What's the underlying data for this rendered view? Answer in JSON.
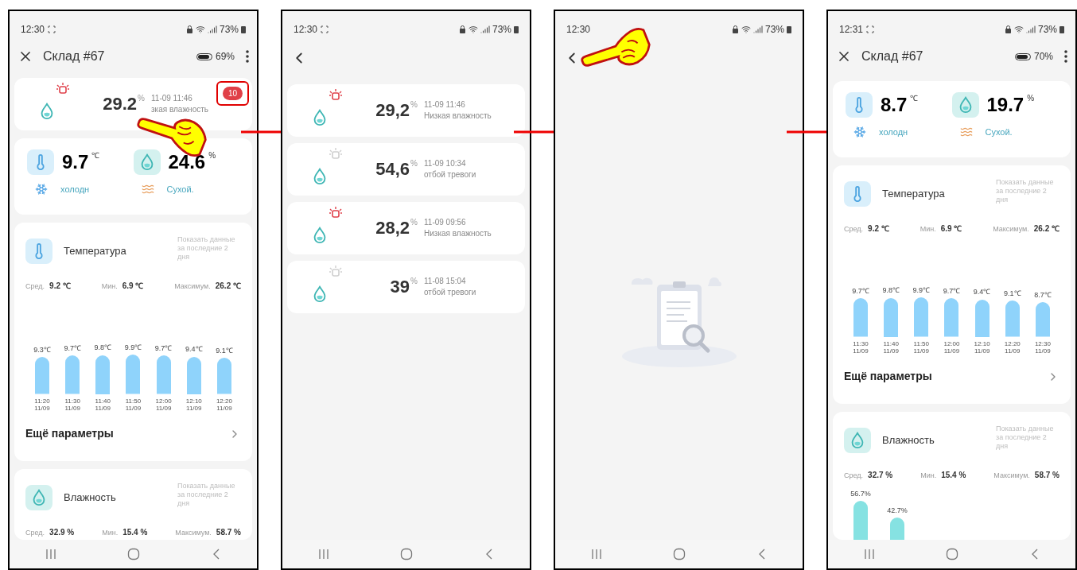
{
  "screens": [
    {
      "kind": "device",
      "pointer": true,
      "arrow_after": true,
      "status_bar": {
        "time": "12:30",
        "battery": "73%"
      },
      "header": {
        "title": "Склад #67",
        "battery": "69%"
      },
      "alert": {
        "value": "29.2",
        "unit": "%",
        "time": "11-09 11:46",
        "message": "зкая влажность",
        "alarm": true,
        "badge": "10",
        "highlighted": true
      },
      "readings": [
        {
          "kind": "temperature",
          "value": "9.7",
          "unit": "℃",
          "status": "холодн"
        },
        {
          "kind": "humidity",
          "value": "24.6",
          "unit": "%",
          "status": "Сухой."
        }
      ],
      "sections": [
        {
          "kind": "temperature",
          "title": "Температура",
          "hint": "Показать данные за последние 2 дня",
          "stats": [
            {
              "label": "Сред.",
              "value": "9.2",
              "unit": "℃"
            },
            {
              "label": "Мин.",
              "value": "6.9",
              "unit": "℃"
            },
            {
              "label": "Максимум.",
              "value": "26.2",
              "unit": "℃"
            }
          ],
          "chart_data": {
            "type": "bar",
            "categories": [
              "11:20 11/09",
              "11:30 11/09",
              "11:40 11/09",
              "11:50 11/09",
              "12:00 11/09",
              "12:10 11/09",
              "12:20 11/09"
            ],
            "values": [
              9.3,
              9.7,
              9.8,
              9.9,
              9.7,
              9.4,
              9.1
            ],
            "value_labels": [
              "9.3℃",
              "9.7℃",
              "9.8℃",
              "9.9℃",
              "9.7℃",
              "9.4℃",
              "9.1℃"
            ]
          },
          "more": "Ещё параметры"
        },
        {
          "kind": "humidity",
          "title": "Влажность",
          "hint": "Показать данные за последние 2 дня",
          "stats": [
            {
              "label": "Сред.",
              "value": "32.9",
              "unit": "%"
            },
            {
              "label": "Мин.",
              "value": "15.4",
              "unit": "%"
            },
            {
              "label": "Максимум.",
              "value": "58.7",
              "unit": "%"
            }
          ]
        }
      ]
    },
    {
      "kind": "alerts",
      "pointer": false,
      "arrow_after": true,
      "status_bar": {
        "time": "12:30",
        "battery": "73%"
      },
      "alerts": [
        {
          "value": "29,2",
          "unit": "%",
          "time": "11-09 11:46",
          "message": "Низкая влажность",
          "alarm": true
        },
        {
          "value": "54,6",
          "unit": "%",
          "time": "11-09 10:34",
          "message": "отбой тревоги",
          "alarm": false
        },
        {
          "value": "28,2",
          "unit": "%",
          "time": "11-09 09:56",
          "message": "Низкая влажность",
          "alarm": true
        },
        {
          "value": "39",
          "unit": "%",
          "time": "11-08 15:04",
          "message": "отбой тревоги",
          "alarm": false
        }
      ]
    },
    {
      "kind": "empty",
      "pointer": true,
      "arrow_after": true,
      "status_bar": {
        "time": "12:30",
        "battery": "73%"
      }
    },
    {
      "kind": "device",
      "pointer": false,
      "arrow_after": false,
      "status_bar": {
        "time": "12:31",
        "battery": "73%"
      },
      "header": {
        "title": "Склад #67",
        "battery": "70%"
      },
      "readings": [
        {
          "kind": "temperature",
          "value": "8.7",
          "unit": "℃",
          "status": "холодн"
        },
        {
          "kind": "humidity",
          "value": "19.7",
          "unit": "%",
          "status": "Сухой."
        }
      ],
      "sections": [
        {
          "kind": "temperature",
          "title": "Температура",
          "hint": "Показать данные за последние 2 дня",
          "stats": [
            {
              "label": "Сред.",
              "value": "9.2",
              "unit": "℃"
            },
            {
              "label": "Мин.",
              "value": "6.9",
              "unit": "℃"
            },
            {
              "label": "Максимум.",
              "value": "26.2",
              "unit": "℃"
            }
          ],
          "chart_data": {
            "type": "bar",
            "categories": [
              "11:30 11/09",
              "11:40 11/09",
              "11:50 11/09",
              "12:00 11/09",
              "12:10 11/09",
              "12:20 11/09",
              "12:30 11/09"
            ],
            "values": [
              9.7,
              9.8,
              9.9,
              9.7,
              9.4,
              9.1,
              8.7
            ],
            "value_labels": [
              "9.7℃",
              "9.8℃",
              "9.9℃",
              "9.7℃",
              "9.4℃",
              "9.1℃",
              "8.7℃"
            ]
          },
          "more": "Ещё параметры"
        },
        {
          "kind": "humidity",
          "title": "Влажность",
          "hint": "Показать данные за последние 2 дня",
          "stats": [
            {
              "label": "Сред.",
              "value": "32.7",
              "unit": "%"
            },
            {
              "label": "Мин.",
              "value": "15.4",
              "unit": "%"
            },
            {
              "label": "Максимум.",
              "value": "58.7",
              "unit": "%"
            }
          ],
          "preview_bars": [
            {
              "label": "56.7%"
            },
            {
              "label": "42.7%"
            }
          ]
        }
      ]
    }
  ]
}
